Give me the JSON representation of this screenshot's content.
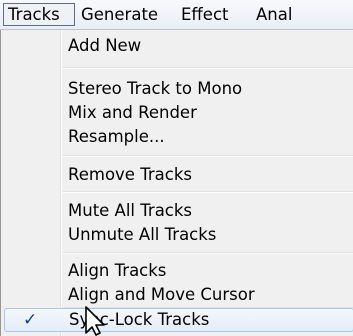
{
  "menubar": {
    "items": [
      {
        "label": "Tracks"
      },
      {
        "label": "Generate"
      },
      {
        "label": "Effect"
      },
      {
        "label": "Anal"
      }
    ]
  },
  "menu": {
    "items": [
      {
        "label": "Add New"
      },
      {
        "label": "Stereo Track to Mono"
      },
      {
        "label": "Mix and Render"
      },
      {
        "label": "Resample..."
      },
      {
        "label": "Remove Tracks"
      },
      {
        "label": "Mute All Tracks"
      },
      {
        "label": "Unmute All Tracks"
      },
      {
        "label": "Align Tracks"
      },
      {
        "label": "Align and Move Cursor"
      },
      {
        "label": "Sync-Lock Tracks",
        "checked": true
      }
    ],
    "check_glyph": "✓"
  },
  "colors": {
    "menubar_bg": "#e9eef6",
    "menu_bg": "#f0f0f0",
    "highlight_border": "#aac6ea",
    "check_color": "#1a3d8c"
  },
  "icons": {
    "cursor": "arrow-cursor-icon",
    "check": "checkmark-icon"
  }
}
